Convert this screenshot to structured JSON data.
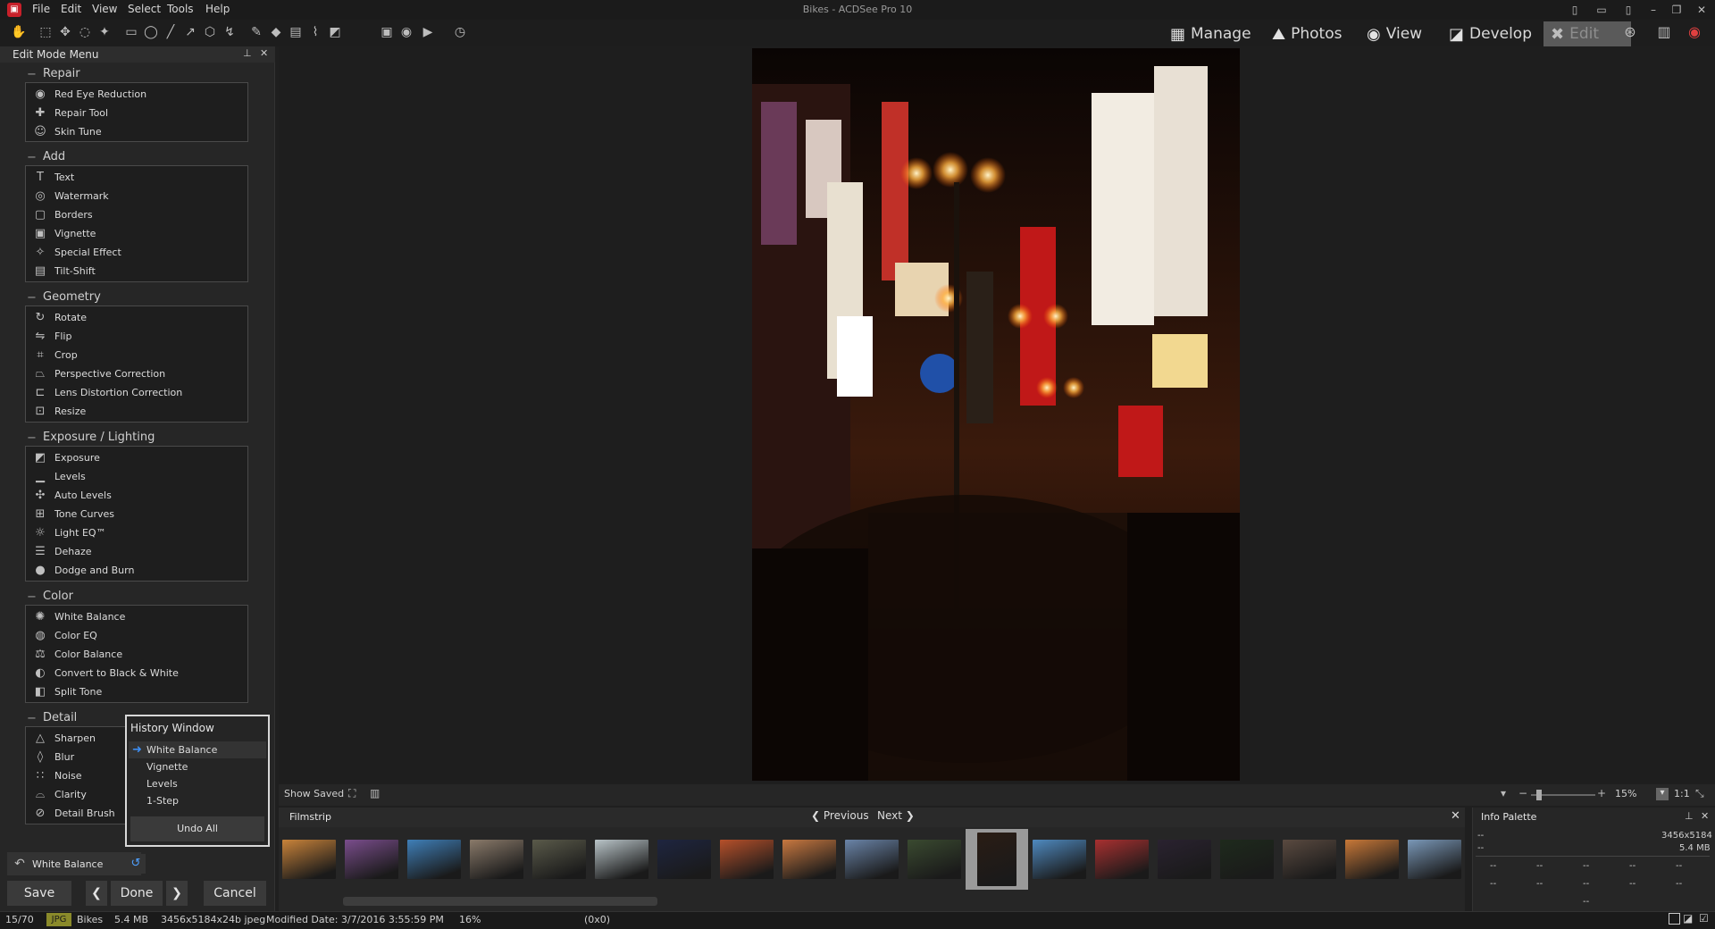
{
  "app": {
    "title": "Bikes - ACDSee Pro 10",
    "menu": [
      "File",
      "Edit",
      "View",
      "Select",
      "Tools",
      "Help"
    ]
  },
  "modes": [
    {
      "label": "Manage",
      "icon": "grid-icon"
    },
    {
      "label": "Photos",
      "icon": "photos-icon"
    },
    {
      "label": "View",
      "icon": "eye-icon"
    },
    {
      "label": "Develop",
      "icon": "develop-icon"
    },
    {
      "label": "Edit",
      "icon": "edit-icon",
      "active": true
    }
  ],
  "left_panel": {
    "title": "Edit Mode Menu",
    "sections": [
      {
        "title": "Repair",
        "items": [
          "Red Eye Reduction",
          "Repair Tool",
          "Skin Tune"
        ]
      },
      {
        "title": "Add",
        "items": [
          "Text",
          "Watermark",
          "Borders",
          "Vignette",
          "Special Effect",
          "Tilt-Shift"
        ]
      },
      {
        "title": "Geometry",
        "items": [
          "Rotate",
          "Flip",
          "Crop",
          "Perspective Correction",
          "Lens Distortion Correction",
          "Resize"
        ]
      },
      {
        "title": "Exposure / Lighting",
        "items": [
          "Exposure",
          "Levels",
          "Auto Levels",
          "Tone Curves",
          "Light EQ™",
          "Dehaze",
          "Dodge and Burn"
        ]
      },
      {
        "title": "Color",
        "items": [
          "White Balance",
          "Color EQ",
          "Color Balance",
          "Convert to Black & White",
          "Split Tone"
        ]
      },
      {
        "title": "Detail",
        "items": [
          "Sharpen",
          "Blur",
          "Noise",
          "Clarity",
          "Detail Brush"
        ]
      }
    ]
  },
  "history": {
    "title": "History Window",
    "items": [
      "White Balance",
      "Vignette",
      "Levels",
      "1-Step"
    ],
    "undo_all": "Undo All"
  },
  "bottom_controls": {
    "current_tool": "White Balance",
    "save": "Save",
    "done": "Done",
    "cancel": "Cancel"
  },
  "view_strip": {
    "show_saved": "Show Saved",
    "zoom": "15%",
    "one_to_one": "1:1"
  },
  "filmstrip": {
    "title": "Filmstrip",
    "previous": "Previous",
    "next": "Next",
    "thumb_colors": [
      "#c9833a",
      "#7a4d8c",
      "#3f7fb8",
      "#8a7a6a",
      "#5a5a4a",
      "#b9c4c8",
      "#1e2540",
      "#b6502a",
      "#c87840",
      "#6a84a8",
      "#3a4a30",
      "#2a1c14",
      "#4f8ac0",
      "#a83030",
      "#2a2230",
      "#1e2a1c",
      "#5a4a40",
      "#c87838",
      "#7a98b8"
    ],
    "selected_index": 11
  },
  "info_palette": {
    "title": "Info Palette",
    "left_top": "--",
    "left_mid": "--",
    "dimensions": "3456x5184",
    "size": "5.4 MB",
    "cells": "--"
  },
  "status": {
    "index": "15/70",
    "type": "JPG",
    "name": "Bikes",
    "size": "5.4 MB",
    "dims": "3456x5184x24b jpeg",
    "modified": "Modified Date: 3/7/2016 3:55:59 PM",
    "zoom": "16%",
    "coords": "(0x0)"
  },
  "colors": {
    "accent": "#3d8df0",
    "badge_yellow": "#8a8a2a"
  }
}
